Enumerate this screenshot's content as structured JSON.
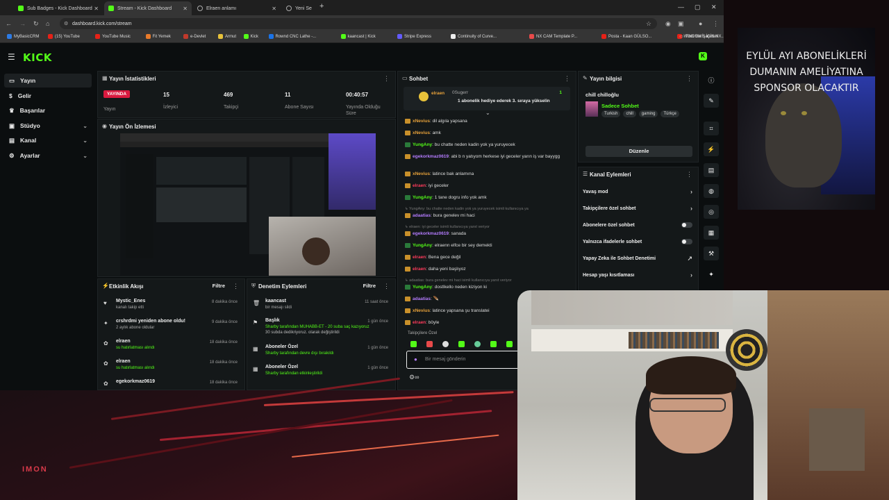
{
  "browser": {
    "tabs": [
      {
        "title": "Sub Badges - Kick Dashboard",
        "icon": "kick-icon"
      },
      {
        "title": "Stream - Kick Dashboard",
        "icon": "kick-icon"
      },
      {
        "title": "Elraen anlamı",
        "icon": "globe-icon"
      },
      {
        "title": "Yeni Se",
        "icon": "globe-icon"
      }
    ],
    "url": "dashboard.kick.com/stream",
    "bookmarks": [
      "MyBasicCRM",
      "(15) YouTube",
      "YouTube Music",
      "Fit Yemek",
      "e-Devlet",
      "Armut",
      "Kick",
      "Rownd CNC Lathe -...",
      "kaancast | Kick",
      "Stripe Express",
      "Continuity of Curve...",
      "NX CAM Template P...",
      "Posta - Kaan GÜLSO...",
      "WINDOWS İÇİN NX...",
      "ChatGPT"
    ],
    "all_bookmarks": "Tüm Yer İşaretleri"
  },
  "kick": {
    "logo": "KICK",
    "sidebar": [
      {
        "label": "Yayın",
        "icon": "stream-icon",
        "active": true
      },
      {
        "label": "Gelir",
        "icon": "money-icon"
      },
      {
        "label": "Başarılar",
        "icon": "trophy-icon"
      },
      {
        "label": "Stüdyo",
        "icon": "studio-icon"
      },
      {
        "label": "Kanal",
        "icon": "channel-icon"
      },
      {
        "label": "Ayarlar",
        "icon": "gear-icon"
      }
    ],
    "stats": {
      "title": "Yayın İstatistikleri",
      "live_badge": "YAYINDA",
      "live_label": "Yayın",
      "viewers": "15",
      "viewers_label": "İzleyici",
      "followers": "469",
      "followers_label": "Takipçi",
      "subs": "11",
      "subs_label": "Abone Sayısı",
      "uptime": "00:40:57",
      "uptime_label": "Yayında Olduğu Süre"
    },
    "preview": {
      "title": "Yayın Ön İzlemesi"
    },
    "activity": {
      "title": "Etkinlik Akışı",
      "filter": "Filtre",
      "items": [
        {
          "name": "Mystic_Enes",
          "sub": "kanalı takip etti",
          "time": "8 dakika önce"
        },
        {
          "name": "crshrdmi yeniden abone oldu!",
          "sub": "2 aylık abone oldular",
          "time": "9 dakika önce"
        },
        {
          "name": "elraen",
          "sub": "su hatırlatması alındı",
          "time": "18 dakika önce"
        },
        {
          "name": "elraen",
          "sub": "su hatırlatması alındı",
          "time": "18 dakika önce"
        },
        {
          "name": "egekorkmaz0619",
          "sub": "",
          "time": "18 dakika önce"
        }
      ]
    },
    "moderation": {
      "title": "Denetim Eylemleri",
      "filter": "Filtre",
      "items": [
        {
          "name": "kaancast",
          "sub": "bir mesajı sildi",
          "time": "11 saat önce"
        },
        {
          "name": "Başlık",
          "sub1": "Sharby tarafından MUHABB-ET - 20 suba saç kazıyoruz",
          "sub2": "30 subda dedikriyoruz. olarak değiştirildi",
          "time": "1 gün önce"
        },
        {
          "name": "Aboneler Özel",
          "sub1": "Sharby tarafından devre dışı bırakıldı",
          "sub2": "",
          "time": "1 gün önce"
        },
        {
          "name": "Aboneler Özel",
          "sub1": "Sharby tarafından etkinleştirildi",
          "sub2": "",
          "time": "1 gün önce"
        }
      ]
    },
    "chat": {
      "title": "Sohbet",
      "pinned_user": "elraen",
      "pinned_gift_from": "0Sugerr",
      "pinned_count": "1",
      "pinned_text": "1 abonelik hediye ederek 3. sıraya yükselin",
      "messages": [
        {
          "user": "xNevius",
          "text": "dil algıla yapsana",
          "color": "#e8a23a"
        },
        {
          "user": "xNevius",
          "text": "amk",
          "color": "#e8a23a"
        },
        {
          "user": "YungAny",
          "text": "bu chatte neden kadin yok ya yuruyecek",
          "color": "#53fc18"
        },
        {
          "user": "egekorkmaz0619",
          "text": "abi b n yatıyom herkese iyi geceler yarın iş var bayygg",
          "color": "#b57cff"
        },
        {
          "user": "xNevius",
          "text": "latince bak anlamına",
          "color": "#e8a23a"
        },
        {
          "user": "elraen",
          "text": "iyi geceler",
          "color": "#ff3b5c"
        },
        {
          "user": "YungAny",
          "text": "1 tane dogru info yok amk",
          "color": "#53fc18"
        },
        {
          "user": "↳ YungAny: bu chatte neden kadin yok ya yuruyecek isimli kullanıcıya ya",
          "text": "",
          "color": "#888",
          "reply": true
        },
        {
          "user": "adaatias",
          "text": "bura genelev mi haci",
          "color": "#b57cff"
        },
        {
          "user": "↳ elraen: iyi geceler isimli kullanıcıya yanıt veriyor",
          "text": "",
          "color": "#888",
          "reply": true
        },
        {
          "user": "egekorkmaz0619",
          "text": "sanada",
          "color": "#b57cff"
        },
        {
          "user": "YungAny",
          "text": "elraenn elfce bir sey demekti",
          "color": "#53fc18"
        },
        {
          "user": "elraen",
          "text": "Bena gece değil",
          "color": "#ff3b5c"
        },
        {
          "user": "elraen",
          "text": "daha yeni başlıyoz",
          "color": "#ff3b5c"
        },
        {
          "user": "↳ adaatias: bura genelev mi haci isimli kullanıcıya yanıt veriyor",
          "text": "",
          "color": "#888",
          "reply": true
        },
        {
          "user": "YungAny",
          "text": "dostlkello neden kiziyon ki",
          "color": "#53fc18"
        },
        {
          "user": "adaatias",
          "text": "🪶",
          "color": "#b57cff"
        },
        {
          "user": "xNevius",
          "text": "latince yapsana şu translatei",
          "color": "#e8a23a"
        },
        {
          "user": "elraen",
          "text": "böyle",
          "color": "#ff3b5c"
        }
      ],
      "followers_only": "Takipçilere Özel",
      "placeholder": "Bir mesaj gönderin"
    },
    "stream_info": {
      "title": "Yayın bilgisi",
      "stream_title": "chill chilloğlu",
      "category": "Sadece Sohbet",
      "tags": [
        "Turkish",
        "chill",
        "gaming",
        "Türkçe"
      ],
      "edit": "Düzenle"
    },
    "channel_actions": {
      "title": "Kanal Eylemleri",
      "items": [
        {
          "label": "Yavaş mod",
          "control": "arrow"
        },
        {
          "label": "Takipçilere özel sohbet",
          "control": "arrow"
        },
        {
          "label": "Abonelere özel sohbet",
          "control": "toggle"
        },
        {
          "label": "Yalnızca ifadelerle sohbet",
          "control": "toggle"
        },
        {
          "label": "Yapay Zeka ile Sohbet Denetimi",
          "control": "external"
        },
        {
          "label": "Hesap yaşı kısıtlaması",
          "control": "arrow"
        }
      ]
    }
  },
  "overlay": {
    "banner": "EYLÜL AYI ABONELİKLERİ DUMANIN AMELİYATINA SPONSOR OLACAKTIR",
    "logo_text": "IMON"
  }
}
